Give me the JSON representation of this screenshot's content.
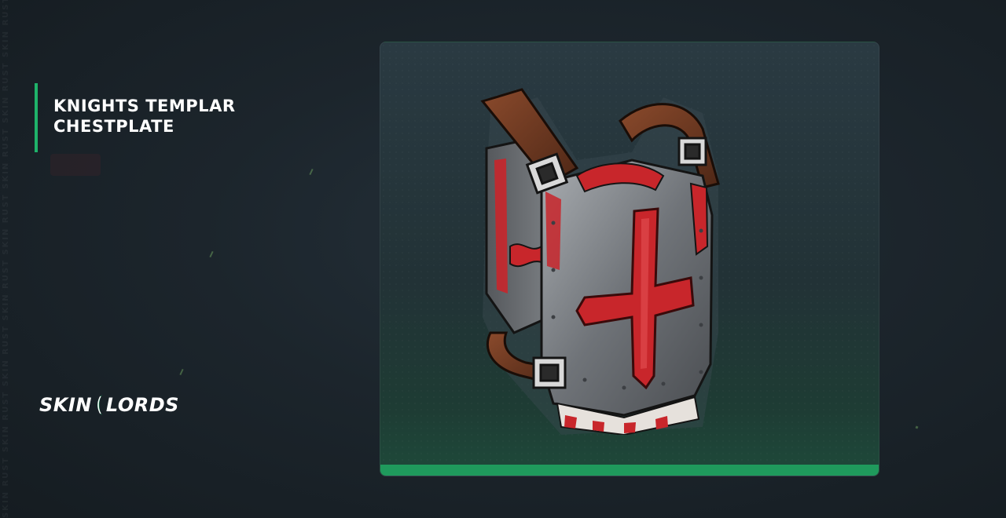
{
  "watermark": {
    "text": "SKIN RUST SKIN RUST SKIN RUST SKIN RUST SKIN RUST SKIN RUST SKIN RUST SKIN RUST"
  },
  "item": {
    "title_line_1": "KNIGHTS TEMPLAR",
    "title_line_2": "CHESTPLATE"
  },
  "brand": {
    "left": "SKIN",
    "right": "LORDS"
  },
  "colors": {
    "accent": "#1fb36a",
    "card_bar": "#1f9a5c",
    "armor_red": "#c8262b",
    "armor_steel": "#7d8186",
    "strap_leather": "#6b3a24"
  },
  "icons": {
    "item": "knights-templar-chestplate-image",
    "logo_mark": "skinlords-crescent-mark"
  }
}
